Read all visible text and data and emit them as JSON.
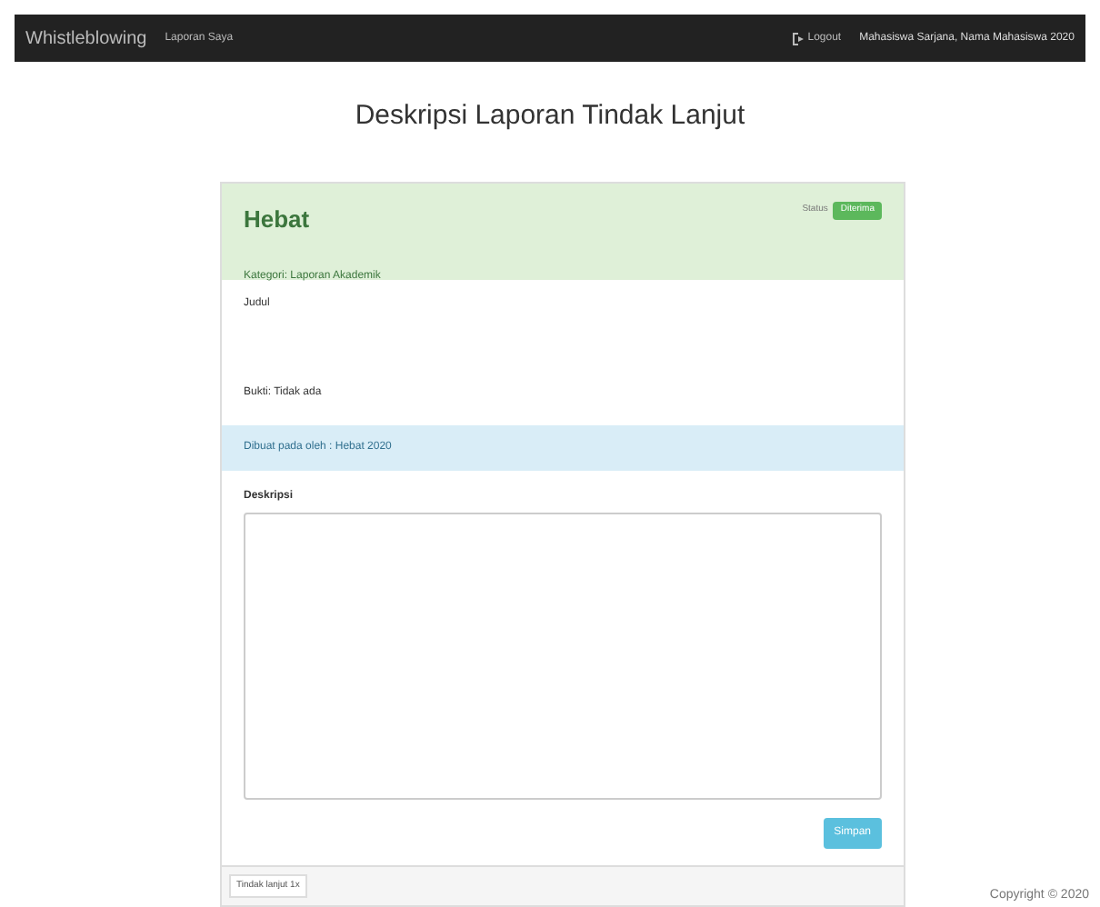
{
  "navbar": {
    "brand": "Whistleblowing",
    "links": [
      "Laporan Saya"
    ],
    "logout": "Logout",
    "user": "Mahasiswa Sarjana, Nama Mahasiswa 2020"
  },
  "page_title": "Deskripsi Laporan Tindak Lanjut",
  "report": {
    "title": "Hebat",
    "status_label": "Status",
    "status": "Diterima",
    "category": "Kategori: Laporan Akademik",
    "judul_label": "Judul",
    "bukti": "Bukti: Tidak ada",
    "created": "Dibuat pada oleh : Hebat 2020"
  },
  "form": {
    "label": "Deskripsi",
    "button": "Simpan"
  },
  "footer_tab": "Tindak lanjut 1x",
  "copyright": "Copyright © 2020"
}
